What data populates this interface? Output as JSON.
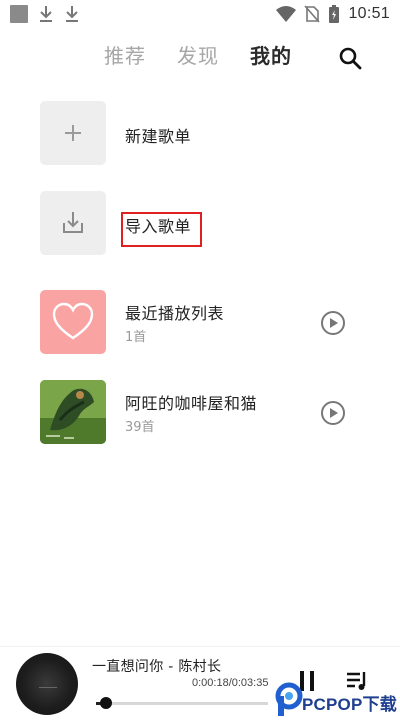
{
  "status_bar": {
    "time": "10:51",
    "left_icons": [
      "gallery-square-icon",
      "download-icon",
      "download-icon"
    ],
    "right_icons": [
      "wifi-icon",
      "no-sim-icon",
      "battery-charging-icon"
    ]
  },
  "tabs": {
    "items": [
      "推荐",
      "发现",
      "我的"
    ],
    "active": "我的"
  },
  "list": [
    {
      "title": "新建歌单",
      "icon": "plus-icon"
    },
    {
      "title": "导入歌单",
      "icon": "import-icon",
      "highlighted": true
    },
    {
      "title": "最近播放列表",
      "subtitle": "1首",
      "icon": "heart-icon",
      "cover_color": "#f9a3a3"
    },
    {
      "title": "阿旺的咖啡屋和猫",
      "subtitle": "39首",
      "icon": "album-cover"
    }
  ],
  "player": {
    "song": "一直想问你 - 陈村长",
    "time": "0:00:18/0:03:35",
    "progress": 0.06
  },
  "watermark": {
    "text": "PCPOP下载"
  },
  "colors": {
    "active_tab": "#2a2a2a",
    "inactive_tab": "#a6a6a6",
    "highlight_box": "#e02020",
    "recent_cover": "#f9a3a3",
    "watermark": "#1f3f8f"
  }
}
